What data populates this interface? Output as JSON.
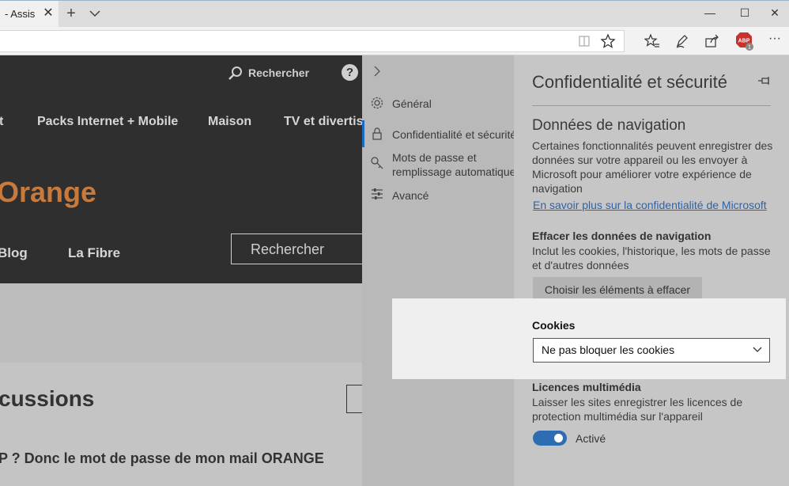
{
  "tabbar": {
    "tab_title": "- Assist",
    "close_glyph": "✕",
    "new_tab_glyph": "+",
    "window_buttons": {
      "minimize": "—",
      "maximize": "☐",
      "close": "✕"
    }
  },
  "toolbar": {
    "icons": [
      "reading-view-icon",
      "favorite-star-icon",
      "favorites-hub-icon",
      "pen-icon",
      "share-icon",
      "adblock-icon",
      "more-icon"
    ],
    "more_glyph": "···",
    "abp_label": "ABP",
    "abp_count": "1"
  },
  "page": {
    "search_top": "Rechercher",
    "nav": [
      "t",
      "Packs Internet + Mobile",
      "Maison",
      "TV et divertiss"
    ],
    "logo": "Orange",
    "subnav": [
      "Blog",
      "La Fibre"
    ],
    "search_box": "Rechercher",
    "heading": "cussions",
    "post_title": "P ? Donc le mot de passe de mon mail ORANGE",
    "question_glyph": "?"
  },
  "settings_nav": {
    "items": [
      {
        "label": "Général",
        "icon": "gear-icon"
      },
      {
        "label": "Confidentialité et sécurité",
        "icon": "lock-icon"
      },
      {
        "label": "Mots de passe et",
        "label2": "remplissage automatique",
        "icon": "key-icon"
      },
      {
        "label": "Avancé",
        "icon": "sliders-icon"
      }
    ]
  },
  "settings": {
    "title": "Confidentialité et sécurité",
    "browsing_data": {
      "heading": "Données de navigation",
      "desc": [
        "Certaines fonctionnalités peuvent enregistrer des",
        "données sur votre appareil ou les envoyer à",
        "Microsoft pour améliorer votre expérience de",
        "navigation"
      ],
      "link": "En savoir plus sur la confidentialité de Microsoft"
    },
    "clear": {
      "heading": "Effacer les données de navigation",
      "desc": [
        "Inclut les cookies, l'historique, les mots de passe",
        "et d'autres données"
      ],
      "button": "Choisir les éléments à effacer"
    },
    "cookies": {
      "label": "Cookies",
      "value": "Ne pas bloquer les cookies"
    },
    "media": {
      "heading": "Licences multimédia",
      "desc": [
        "Laisser les sites enregistrer les licences de",
        "protection multimédia sur l'appareil"
      ],
      "toggle_label": "Activé",
      "toggle_on": true
    }
  },
  "colors": {
    "accent": "#2f6db3",
    "orange": "#c77a3b",
    "link": "#2f63a6"
  }
}
